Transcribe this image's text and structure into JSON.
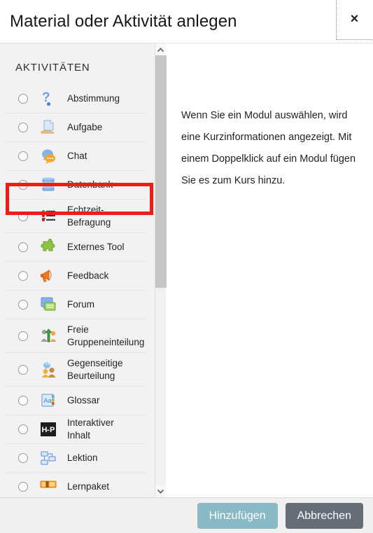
{
  "dialog": {
    "title": "Material oder Aktivität anlegen",
    "close_label": "×",
    "close_icon": "close-icon"
  },
  "list_panel": {
    "section_heading": "AKTIVITÄTEN",
    "items": [
      {
        "label": "Abstimmung",
        "icon": "question-mark-icon",
        "selected": false,
        "two_line": false
      },
      {
        "label": "Aufgabe",
        "icon": "document-hand-icon",
        "selected": false,
        "two_line": false
      },
      {
        "label": "Chat",
        "icon": "speech-bubbles-icon",
        "selected": false,
        "two_line": false,
        "highlighted": true
      },
      {
        "label": "Datenbank",
        "icon": "database-icon",
        "selected": false,
        "two_line": false
      },
      {
        "label": "Echtzeit-Befragung",
        "icon": "checklist-icon",
        "selected": false,
        "two_line": true
      },
      {
        "label": "Externes Tool",
        "icon": "puzzle-piece-icon",
        "selected": false,
        "two_line": false
      },
      {
        "label": "Feedback",
        "icon": "megaphone-icon",
        "selected": false,
        "two_line": false
      },
      {
        "label": "Forum",
        "icon": "forum-bubbles-icon",
        "selected": false,
        "two_line": false
      },
      {
        "label": "Freie Gruppeneinteilung",
        "icon": "group-arrow-icon",
        "selected": false,
        "two_line": true
      },
      {
        "label": "Gegenseitige Beurteilung",
        "icon": "peer-review-icon",
        "selected": false,
        "two_line": true
      },
      {
        "label": "Glossar",
        "icon": "glossary-icon",
        "selected": false,
        "two_line": false
      },
      {
        "label": "Interaktiver Inhalt",
        "icon": "h5p-icon",
        "selected": false,
        "two_line": false
      },
      {
        "label": "Lektion",
        "icon": "flowchart-icon",
        "selected": false,
        "two_line": false
      },
      {
        "label": "Lernpaket",
        "icon": "package-icon",
        "selected": false,
        "two_line": false
      }
    ],
    "highlight_color": "#ed1c16"
  },
  "scrollbar": {
    "up_arrow": "chevron-up-icon",
    "down_arrow": "chevron-down-icon"
  },
  "info_panel": {
    "text": "Wenn Sie ein Modul auswählen, wird eine Kurzinformationen angezeigt. Mit einem Doppelklick auf ein Modul fügen Sie es zum Kurs hinzu."
  },
  "footer": {
    "primary_label": "Hinzufügen",
    "secondary_label": "Abbrechen",
    "primary_color": "#8ab9c6",
    "secondary_color": "#656d78"
  }
}
